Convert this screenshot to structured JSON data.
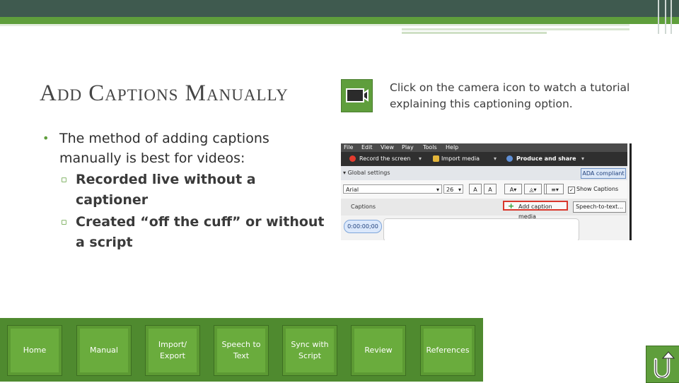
{
  "slide": {
    "title": "Add Captions Manually",
    "camera_hint": "Click on the camera icon to watch a tutorial explaining this captioning option.",
    "camera_icon": "video-camera-icon",
    "bullet_main": "The method of adding captions manually is best for videos:",
    "sub_bullets": [
      "Recorded live without a captioner",
      "Created “off the cuff” or without a script"
    ]
  },
  "screenshot": {
    "menu": [
      "File",
      "Edit",
      "View",
      "Play",
      "Tools",
      "Help"
    ],
    "toolbar": {
      "record": "Record the screen",
      "import": "Import media",
      "produce": "Produce and share"
    },
    "global_settings": "Global settings",
    "ada_button": "ADA compliant",
    "font_name": "Arial",
    "font_size": "26",
    "show_captions": "Show Captions",
    "captions_label": "Captions",
    "add_caption_button": "Add caption media",
    "speech_to_text_button": "Speech-to-text...",
    "timecode": "0:00:00;00"
  },
  "nav": [
    {
      "label": "Home"
    },
    {
      "label": "Manual"
    },
    {
      "label": "Import/ Export"
    },
    {
      "label": "Speech to Text"
    },
    {
      "label": "Sync with Script"
    },
    {
      "label": "Review"
    },
    {
      "label": "References"
    }
  ],
  "home_icon": "u-turn-arrow-icon",
  "colors": {
    "accent_green": "#5f9e3c",
    "header_dark": "#3f5a4f",
    "highlight_red": "#d9372c"
  }
}
